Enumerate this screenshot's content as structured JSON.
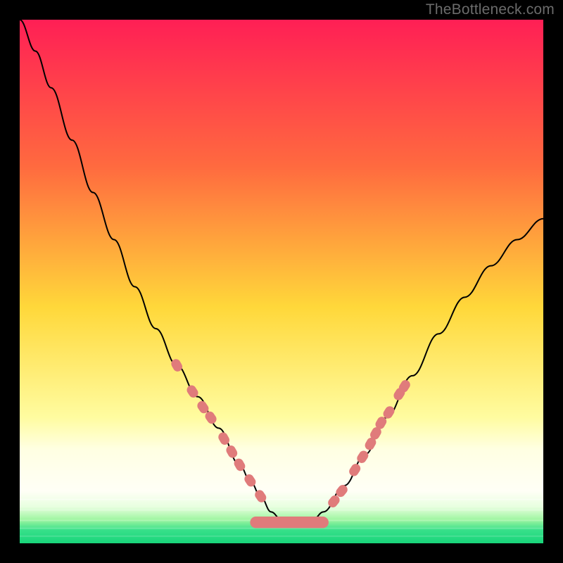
{
  "watermark": "TheBottleneck.com",
  "chart_data": {
    "type": "line",
    "title": "",
    "xlabel": "",
    "ylabel": "",
    "xlim": [
      0,
      100
    ],
    "ylim": [
      0,
      100
    ],
    "background_gradient_stops": [
      {
        "offset": 0.0,
        "color": "#ff1f55"
      },
      {
        "offset": 0.28,
        "color": "#ff6a3f"
      },
      {
        "offset": 0.55,
        "color": "#ffd83a"
      },
      {
        "offset": 0.76,
        "color": "#fffca0"
      },
      {
        "offset": 0.82,
        "color": "#ffffe2"
      },
      {
        "offset": 0.87,
        "color": "#ffffef"
      },
      {
        "offset": 0.9,
        "color": "#fffff6"
      },
      {
        "offset": 0.93,
        "color": "#e8ffe0"
      },
      {
        "offset": 0.955,
        "color": "#9ef5a0"
      },
      {
        "offset": 0.975,
        "color": "#37e08a"
      },
      {
        "offset": 1.0,
        "color": "#18d57a"
      }
    ],
    "series": [
      {
        "name": "bottleneck-curve",
        "color": "#000000",
        "stroke_width": 2,
        "x": [
          0,
          3,
          6,
          10,
          14,
          18,
          22,
          26,
          30,
          34,
          38,
          42,
          44,
          46,
          48,
          50,
          52,
          54,
          56,
          58,
          62,
          66,
          70,
          75,
          80,
          85,
          90,
          95,
          100
        ],
        "y": [
          100,
          94,
          87,
          77,
          67,
          58,
          49,
          41,
          34,
          28,
          22,
          15,
          12,
          9,
          6,
          4.5,
          4,
          4,
          4.5,
          6,
          11,
          17,
          24,
          32,
          40,
          47,
          53,
          58,
          62
        ]
      }
    ],
    "markers": {
      "name": "highlight-dots",
      "color": "#e07b7b",
      "radius": 7,
      "points": [
        {
          "x": 30,
          "y": 34
        },
        {
          "x": 33,
          "y": 29
        },
        {
          "x": 35,
          "y": 26
        },
        {
          "x": 36.5,
          "y": 24
        },
        {
          "x": 39,
          "y": 20
        },
        {
          "x": 40.5,
          "y": 17.5
        },
        {
          "x": 42,
          "y": 15
        },
        {
          "x": 44,
          "y": 12
        },
        {
          "x": 46,
          "y": 9
        },
        {
          "x": 60,
          "y": 8
        },
        {
          "x": 61.5,
          "y": 10
        },
        {
          "x": 64,
          "y": 14
        },
        {
          "x": 65.5,
          "y": 16.5
        },
        {
          "x": 67,
          "y": 19
        },
        {
          "x": 68,
          "y": 21
        },
        {
          "x": 69,
          "y": 23
        },
        {
          "x": 70.5,
          "y": 25
        },
        {
          "x": 72.5,
          "y": 28.5
        },
        {
          "x": 73.5,
          "y": 30
        }
      ],
      "pill": {
        "x_start": 44,
        "x_end": 59,
        "y": 4,
        "height_pct": 2.2
      }
    }
  }
}
